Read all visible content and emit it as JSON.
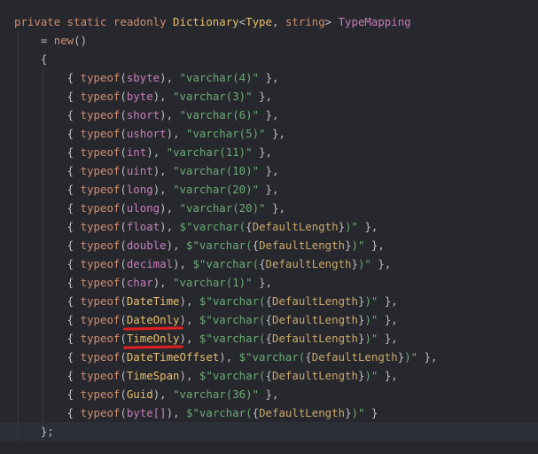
{
  "editor": {
    "lines": [
      [
        [
          "kw",
          "private static readonly "
        ],
        [
          "cls",
          "Dictionary"
        ],
        [
          "pl",
          "<"
        ],
        [
          "cls",
          "Type"
        ],
        [
          "pl",
          ", "
        ],
        [
          "kw",
          "string"
        ],
        [
          "pl",
          "> "
        ],
        [
          "ty",
          "TypeMapping"
        ]
      ],
      [
        [
          "pl",
          "    = "
        ],
        [
          "kw",
          "new"
        ],
        [
          "pl",
          "()"
        ]
      ],
      [
        [
          "pl",
          "    {"
        ]
      ],
      [
        [
          "pl",
          "        { "
        ],
        [
          "kw",
          "typeof"
        ],
        [
          "pl",
          "("
        ],
        [
          "ty",
          "sbyte"
        ],
        [
          "pl",
          "), "
        ],
        [
          "str",
          "\"varchar(4)\""
        ],
        [
          "pl",
          " },"
        ]
      ],
      [
        [
          "pl",
          "        { "
        ],
        [
          "kw",
          "typeof"
        ],
        [
          "pl",
          "("
        ],
        [
          "ty",
          "byte"
        ],
        [
          "pl",
          "), "
        ],
        [
          "str",
          "\"varchar(3)\""
        ],
        [
          "pl",
          " },"
        ]
      ],
      [
        [
          "pl",
          "        { "
        ],
        [
          "kw",
          "typeof"
        ],
        [
          "pl",
          "("
        ],
        [
          "ty",
          "short"
        ],
        [
          "pl",
          "), "
        ],
        [
          "str",
          "\"varchar(6)\""
        ],
        [
          "pl",
          " },"
        ]
      ],
      [
        [
          "pl",
          "        { "
        ],
        [
          "kw",
          "typeof"
        ],
        [
          "pl",
          "("
        ],
        [
          "ty",
          "ushort"
        ],
        [
          "pl",
          "), "
        ],
        [
          "str",
          "\"varchar(5)\""
        ],
        [
          "pl",
          " },"
        ]
      ],
      [
        [
          "pl",
          "        { "
        ],
        [
          "kw",
          "typeof"
        ],
        [
          "pl",
          "("
        ],
        [
          "ty",
          "int"
        ],
        [
          "pl",
          "), "
        ],
        [
          "str",
          "\"varchar(11)\""
        ],
        [
          "pl",
          " },"
        ]
      ],
      [
        [
          "pl",
          "        { "
        ],
        [
          "kw",
          "typeof"
        ],
        [
          "pl",
          "("
        ],
        [
          "ty",
          "uint"
        ],
        [
          "pl",
          "), "
        ],
        [
          "str",
          "\"varchar(10)\""
        ],
        [
          "pl",
          " },"
        ]
      ],
      [
        [
          "pl",
          "        { "
        ],
        [
          "kw",
          "typeof"
        ],
        [
          "pl",
          "("
        ],
        [
          "ty",
          "long"
        ],
        [
          "pl",
          "), "
        ],
        [
          "str",
          "\"varchar(20)\""
        ],
        [
          "pl",
          " },"
        ]
      ],
      [
        [
          "pl",
          "        { "
        ],
        [
          "kw",
          "typeof"
        ],
        [
          "pl",
          "("
        ],
        [
          "ty",
          "ulong"
        ],
        [
          "pl",
          "), "
        ],
        [
          "str",
          "\"varchar(20)\""
        ],
        [
          "pl",
          " },"
        ]
      ],
      [
        [
          "pl",
          "        { "
        ],
        [
          "kw",
          "typeof"
        ],
        [
          "pl",
          "("
        ],
        [
          "ty",
          "float"
        ],
        [
          "pl",
          "), "
        ],
        [
          "str",
          "$\"varchar("
        ],
        [
          "pl",
          "{"
        ],
        [
          "interp",
          "DefaultLength"
        ],
        [
          "pl",
          "}"
        ],
        [
          "str",
          ")\""
        ],
        [
          "pl",
          " },"
        ]
      ],
      [
        [
          "pl",
          "        { "
        ],
        [
          "kw",
          "typeof"
        ],
        [
          "pl",
          "("
        ],
        [
          "ty",
          "double"
        ],
        [
          "pl",
          "), "
        ],
        [
          "str",
          "$\"varchar("
        ],
        [
          "pl",
          "{"
        ],
        [
          "interp",
          "DefaultLength"
        ],
        [
          "pl",
          "}"
        ],
        [
          "str",
          ")\""
        ],
        [
          "pl",
          " },"
        ]
      ],
      [
        [
          "pl",
          "        { "
        ],
        [
          "kw",
          "typeof"
        ],
        [
          "pl",
          "("
        ],
        [
          "ty",
          "decimal"
        ],
        [
          "pl",
          "), "
        ],
        [
          "str",
          "$\"varchar("
        ],
        [
          "pl",
          "{"
        ],
        [
          "interp",
          "DefaultLength"
        ],
        [
          "pl",
          "}"
        ],
        [
          "str",
          ")\""
        ],
        [
          "pl",
          " },"
        ]
      ],
      [
        [
          "pl",
          "        { "
        ],
        [
          "kw",
          "typeof"
        ],
        [
          "pl",
          "("
        ],
        [
          "ty",
          "char"
        ],
        [
          "pl",
          "), "
        ],
        [
          "str",
          "\"varchar(1)\""
        ],
        [
          "pl",
          " },"
        ]
      ],
      [
        [
          "pl",
          "        { "
        ],
        [
          "kw",
          "typeof"
        ],
        [
          "pl",
          "("
        ],
        [
          "cls",
          "DateTime"
        ],
        [
          "pl",
          "), "
        ],
        [
          "str",
          "$\"varchar("
        ],
        [
          "pl",
          "{"
        ],
        [
          "interp",
          "DefaultLength"
        ],
        [
          "pl",
          "}"
        ],
        [
          "str",
          ")\""
        ],
        [
          "pl",
          " },"
        ]
      ],
      [
        [
          "pl",
          "        { "
        ],
        [
          "kw",
          "typeof"
        ],
        [
          "pl",
          "("
        ],
        [
          "cls",
          "DateOnly",
          "squig"
        ],
        [
          "pl",
          "), "
        ],
        [
          "str",
          "$\"varchar("
        ],
        [
          "pl",
          "{"
        ],
        [
          "interp",
          "DefaultLength"
        ],
        [
          "pl",
          "}"
        ],
        [
          "str",
          ")\""
        ],
        [
          "pl",
          " },"
        ]
      ],
      [
        [
          "pl",
          "        { "
        ],
        [
          "kw",
          "typeof"
        ],
        [
          "pl",
          "("
        ],
        [
          "cls",
          "TimeOnly",
          "squig"
        ],
        [
          "pl",
          "), "
        ],
        [
          "str",
          "$\"varchar("
        ],
        [
          "pl",
          "{"
        ],
        [
          "interp",
          "DefaultLength"
        ],
        [
          "pl",
          "}"
        ],
        [
          "str",
          ")\""
        ],
        [
          "pl",
          " },"
        ]
      ],
      [
        [
          "pl",
          "        { "
        ],
        [
          "kw",
          "typeof"
        ],
        [
          "pl",
          "("
        ],
        [
          "cls",
          "DateTimeOffset"
        ],
        [
          "pl",
          "), "
        ],
        [
          "str",
          "$\"varchar("
        ],
        [
          "pl",
          "{"
        ],
        [
          "interp",
          "DefaultLength"
        ],
        [
          "pl",
          "}"
        ],
        [
          "str",
          ")\""
        ],
        [
          "pl",
          " },"
        ]
      ],
      [
        [
          "pl",
          "        { "
        ],
        [
          "kw",
          "typeof"
        ],
        [
          "pl",
          "("
        ],
        [
          "cls",
          "TimeSpan"
        ],
        [
          "pl",
          "), "
        ],
        [
          "str",
          "$\"varchar("
        ],
        [
          "pl",
          "{"
        ],
        [
          "interp",
          "DefaultLength"
        ],
        [
          "pl",
          "}"
        ],
        [
          "str",
          ")\""
        ],
        [
          "pl",
          " },"
        ]
      ],
      [
        [
          "pl",
          "        { "
        ],
        [
          "kw",
          "typeof"
        ],
        [
          "pl",
          "("
        ],
        [
          "cls",
          "Guid"
        ],
        [
          "pl",
          "), "
        ],
        [
          "str",
          "\"varchar(36)\""
        ],
        [
          "pl",
          " },"
        ]
      ],
      [
        [
          "pl",
          "        { "
        ],
        [
          "kw",
          "typeof"
        ],
        [
          "pl",
          "("
        ],
        [
          "ty",
          "byte[]"
        ],
        [
          "pl",
          "), "
        ],
        [
          "str",
          "$\"varchar("
        ],
        [
          "pl",
          "{"
        ],
        [
          "interp",
          "DefaultLength"
        ],
        [
          "pl",
          "}"
        ],
        [
          "str",
          ")\""
        ],
        [
          "pl",
          " }"
        ]
      ],
      [
        [
          "pl",
          "    };"
        ]
      ]
    ],
    "current_line": 22
  }
}
